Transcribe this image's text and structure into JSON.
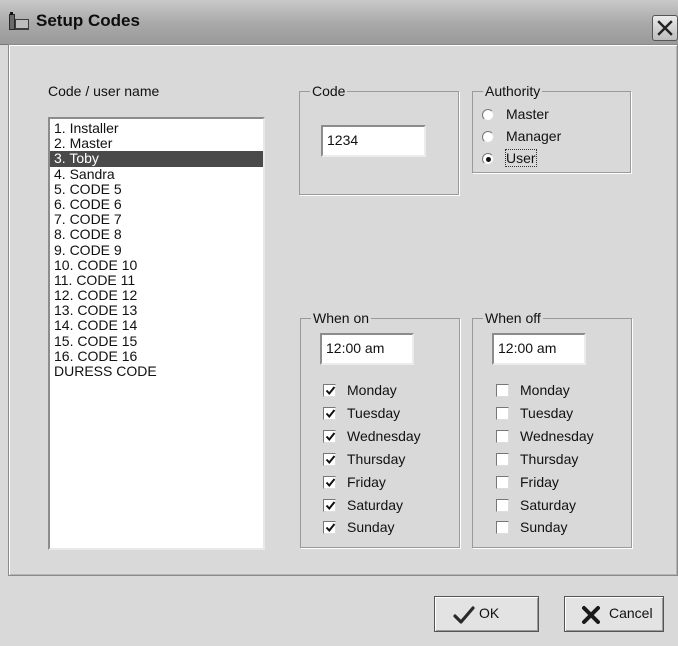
{
  "window": {
    "title": "Setup Codes"
  },
  "list": {
    "label": "Code / user name",
    "items": [
      "1. Installer",
      "2. Master",
      "3. Toby",
      "4. Sandra",
      "5. CODE 5",
      "6. CODE 6",
      "7. CODE 7",
      "8. CODE 8",
      "9. CODE 9",
      "10. CODE 10",
      "11. CODE 11",
      "12. CODE 12",
      "13. CODE 13",
      "14. CODE 14",
      "15. CODE 15",
      "16. CODE 16",
      "DURESS CODE"
    ],
    "selected_index": 2
  },
  "code": {
    "label": "Code",
    "value": "1234"
  },
  "authority": {
    "label": "Authority",
    "options": [
      "Master",
      "Manager",
      "User"
    ],
    "selected": "User"
  },
  "when_on": {
    "label": "When on",
    "time": "12:00 am",
    "days": [
      {
        "name": "Monday",
        "checked": true
      },
      {
        "name": "Tuesday",
        "checked": true
      },
      {
        "name": "Wednesday",
        "checked": true
      },
      {
        "name": "Thursday",
        "checked": true
      },
      {
        "name": "Friday",
        "checked": true
      },
      {
        "name": "Saturday",
        "checked": true
      },
      {
        "name": "Sunday",
        "checked": true
      }
    ]
  },
  "when_off": {
    "label": "When off",
    "time": "12:00 am",
    "days": [
      {
        "name": "Monday",
        "checked": false
      },
      {
        "name": "Tuesday",
        "checked": false
      },
      {
        "name": "Wednesday",
        "checked": false
      },
      {
        "name": "Thursday",
        "checked": false
      },
      {
        "name": "Friday",
        "checked": false
      },
      {
        "name": "Saturday",
        "checked": false
      },
      {
        "name": "Sunday",
        "checked": false
      }
    ]
  },
  "buttons": {
    "ok": "OK",
    "cancel": "Cancel"
  },
  "icons": {
    "title": "app-window-icon",
    "close": "close-icon",
    "ok": "checkmark-icon",
    "cancel": "x-cross-icon"
  }
}
